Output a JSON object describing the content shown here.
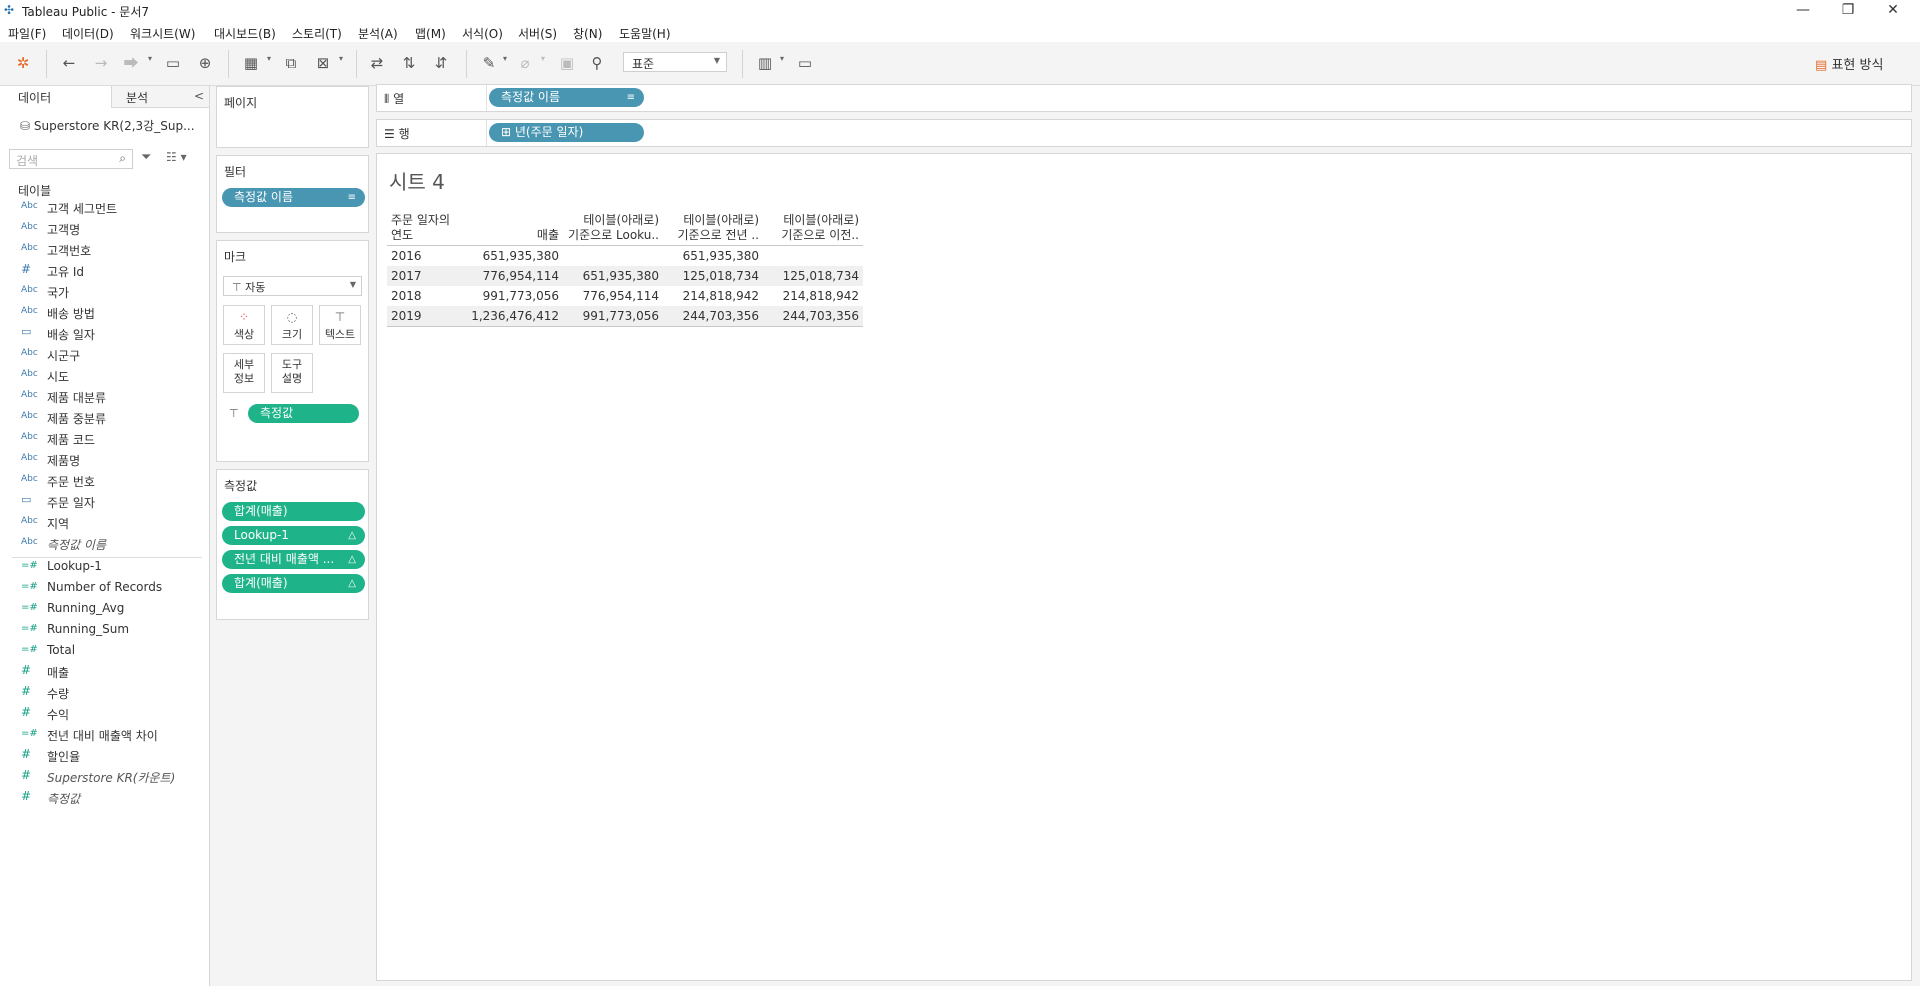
{
  "window": {
    "title": "Tableau Public - 문서7",
    "minimize": "—",
    "restore": "❐",
    "close": "✕"
  },
  "menu": [
    "파일(F)",
    "데이터(D)",
    "워크시트(W)",
    "대시보드(B)",
    "스토리(T)",
    "분석(A)",
    "맵(M)",
    "서식(O)",
    "서버(S)",
    "창(N)",
    "도움말(H)"
  ],
  "toolbar": {
    "format_value": "표준",
    "show_me_label": "표현 방식"
  },
  "data_pane": {
    "tab_data": "데이터",
    "tab_analytics": "분석",
    "collapse": "<",
    "datasource": "Superstore KR(2,3강_Sup...",
    "search_placeholder": "검색",
    "tables_header": "테이블",
    "dimensions": [
      {
        "type": "Abc",
        "label": "고객 세그먼트"
      },
      {
        "type": "Abc",
        "label": "고객명"
      },
      {
        "type": "Abc",
        "label": "고객번호"
      },
      {
        "type": "#",
        "label": "고유 Id"
      },
      {
        "type": "Abc",
        "label": "국가"
      },
      {
        "type": "Abc",
        "label": "배송 방법"
      },
      {
        "type": "date",
        "label": "배송 일자"
      },
      {
        "type": "Abc",
        "label": "시군구"
      },
      {
        "type": "Abc",
        "label": "시도"
      },
      {
        "type": "Abc",
        "label": "제품 대분류"
      },
      {
        "type": "Abc",
        "label": "제품 중분류"
      },
      {
        "type": "Abc",
        "label": "제품 코드"
      },
      {
        "type": "Abc",
        "label": "제품명"
      },
      {
        "type": "Abc",
        "label": "주문 번호"
      },
      {
        "type": "date",
        "label": "주문 일자"
      },
      {
        "type": "Abc",
        "label": "지역"
      },
      {
        "type": "Abc",
        "label": "측정값 이름",
        "italic": true
      }
    ],
    "measures": [
      {
        "type": "calc",
        "label": "Lookup-1"
      },
      {
        "type": "calc",
        "label": "Number of Records"
      },
      {
        "type": "calc",
        "label": "Running_Avg"
      },
      {
        "type": "calc",
        "label": "Running_Sum"
      },
      {
        "type": "calc",
        "label": "Total"
      },
      {
        "type": "#",
        "label": "매출"
      },
      {
        "type": "#",
        "label": "수량"
      },
      {
        "type": "#",
        "label": "수익"
      },
      {
        "type": "calc",
        "label": "전년 대비 매출액 차이"
      },
      {
        "type": "#",
        "label": "할인율"
      },
      {
        "type": "#",
        "label": "Superstore KR(카운트)",
        "italic": true
      },
      {
        "type": "#",
        "label": "측정값",
        "italic": true
      }
    ]
  },
  "pages_card": {
    "title": "페이지"
  },
  "filters_card": {
    "title": "필터",
    "pill": "측정값 이름"
  },
  "marks_card": {
    "title": "마크",
    "type": "자동",
    "buttons": {
      "color": "색상",
      "size": "크기",
      "text": "텍스트",
      "detail_1": "세부",
      "detail_2": "정보",
      "tooltip_1": "도구",
      "tooltip_2": "설명"
    },
    "text_pill": "측정값"
  },
  "measure_values_card": {
    "title": "측정값",
    "pills": [
      "합계(매출)",
      "Lookup-1",
      "전년 대비 매출액 ...",
      "합계(매출)"
    ]
  },
  "columns_shelf": {
    "label": "열",
    "pill": "측정값 이름"
  },
  "rows_shelf": {
    "label": "행",
    "pill": "년(주문 일자)"
  },
  "view": {
    "sheet_title": "시트 4",
    "table": {
      "header_row_label_1": "주문 일자의",
      "header_row_label_2": "연도",
      "columns": [
        {
          "l1": "",
          "l2": "매출"
        },
        {
          "l1": "테이블(아래로)",
          "l2": "기준으로 Looku.."
        },
        {
          "l1": "테이블(아래로)",
          "l2": "기준으로 전년 .."
        },
        {
          "l1": "테이블(아래로)",
          "l2": "기준으로 이전.."
        }
      ],
      "rows": [
        {
          "year": "2016",
          "c1": "651,935,380",
          "c2": "",
          "c3": "651,935,380",
          "c4": ""
        },
        {
          "year": "2017",
          "c1": "776,954,114",
          "c2": "651,935,380",
          "c3": "125,018,734",
          "c4": "125,018,734"
        },
        {
          "year": "2018",
          "c1": "991,773,056",
          "c2": "776,954,114",
          "c3": "214,818,942",
          "c4": "214,818,942"
        },
        {
          "year": "2019",
          "c1": "1,236,476,412",
          "c2": "991,773,056",
          "c3": "244,703,356",
          "c4": "244,703,356"
        }
      ]
    }
  },
  "colors": {
    "pill_blue": "#4996b2",
    "pill_green": "#1fb38a"
  }
}
